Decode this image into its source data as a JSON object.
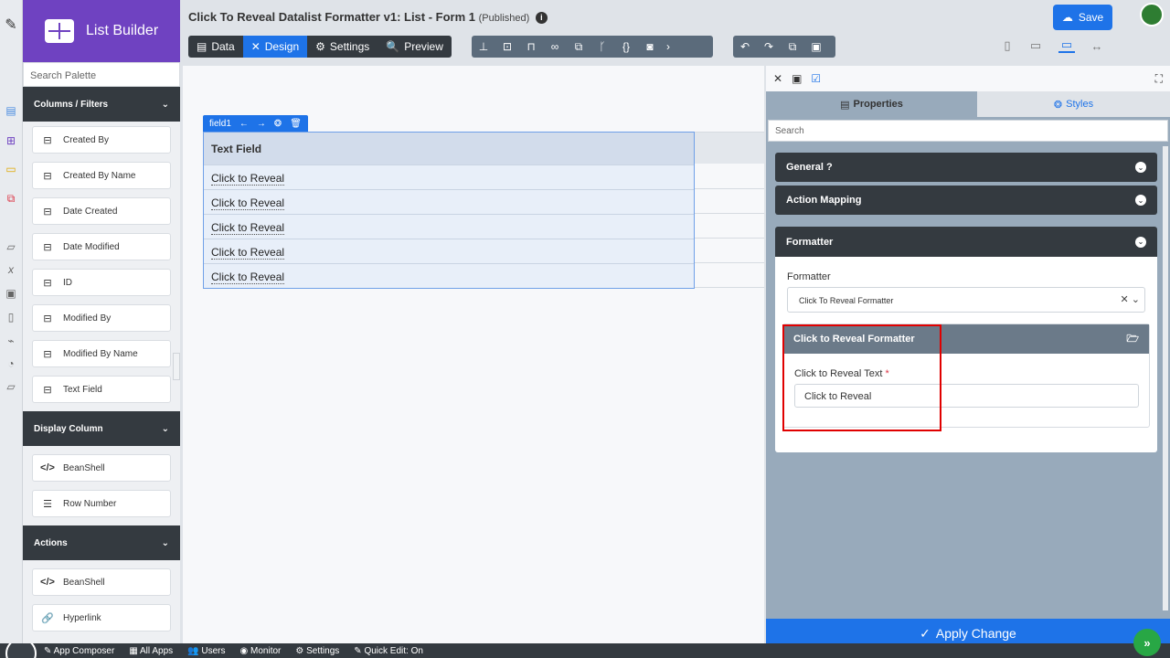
{
  "app": {
    "brand": "List Builder",
    "title": "Click To Reveal Datalist Formatter v1: List - Form 1",
    "status": "(Published)",
    "save_label": "Save"
  },
  "tabs": [
    {
      "label": "Data",
      "icon": "table-icon"
    },
    {
      "label": "Design",
      "icon": "tools-icon",
      "active": true
    },
    {
      "label": "Settings",
      "icon": "gear-icon"
    },
    {
      "label": "Preview",
      "icon": "preview-icon"
    }
  ],
  "palette": {
    "search_placeholder": "Search Palette",
    "sections": [
      {
        "title": "Columns / Filters",
        "items": [
          "Created By",
          "Created By Name",
          "Date Created",
          "Date Modified",
          "ID",
          "Modified By",
          "Modified By Name",
          "Text Field"
        ]
      },
      {
        "title": "Display Column",
        "items": [
          "BeanShell",
          "Row Number"
        ]
      },
      {
        "title": "Actions",
        "items": [
          "BeanShell",
          "Hyperlink"
        ]
      }
    ]
  },
  "canvas": {
    "field_tag": "field1",
    "column_header": "Text Field",
    "rows": [
      "Click to Reveal",
      "Click to Reveal",
      "Click to Reveal",
      "Click to Reveal",
      "Click to Reveal"
    ]
  },
  "properties": {
    "tab_properties": "Properties",
    "tab_styles": "Styles",
    "search_placeholder": "Search",
    "sections": {
      "general": "General",
      "action_mapping": "Action Mapping",
      "formatter": "Formatter"
    },
    "formatter_label": "Formatter",
    "formatter_value": "Click To Reveal Formatter",
    "sub_title": "Click to Reveal Formatter",
    "field_label": "Click to Reveal Text",
    "required_mark": "*",
    "field_value": "Click to Reveal",
    "apply_label": "Apply Change"
  },
  "bottom": {
    "items": [
      "App Composer",
      "All Apps",
      "Users",
      "Monitor",
      "Settings",
      "Quick Edit: On"
    ]
  },
  "colors": {
    "brand": "#6f42c1",
    "accent": "#1e73e8",
    "dark": "#343a40",
    "highlight": "#e00000"
  }
}
